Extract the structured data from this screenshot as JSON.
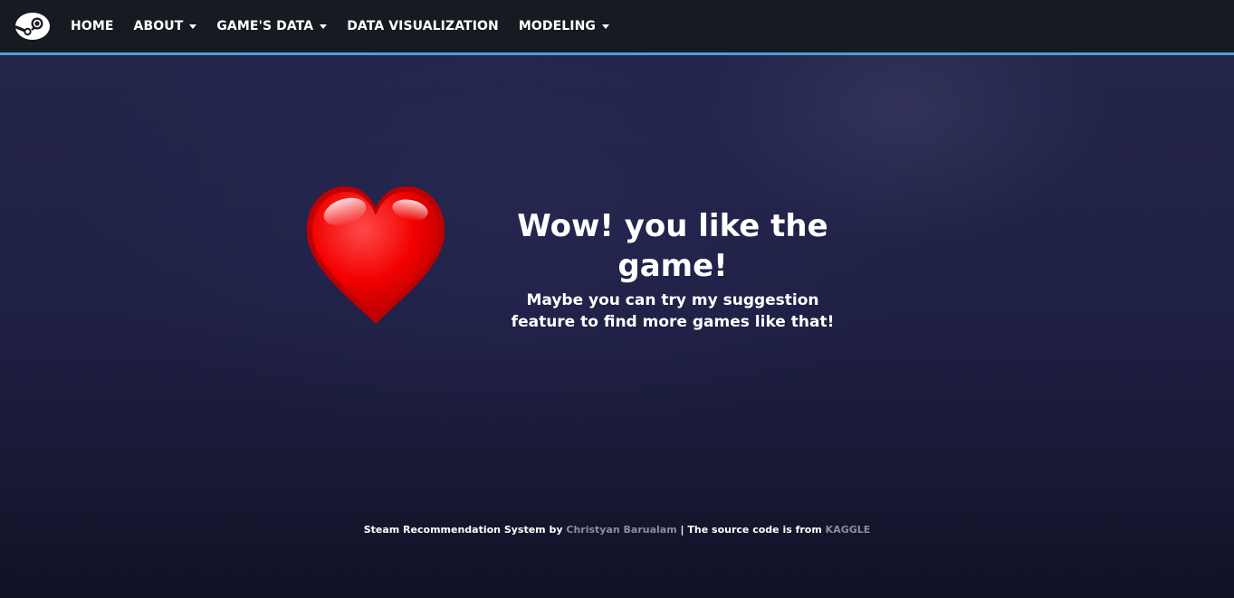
{
  "nav": {
    "logo_icon": "steam-logo-icon",
    "items": [
      {
        "label": "HOME",
        "dropdown": false
      },
      {
        "label": "ABOUT",
        "dropdown": true
      },
      {
        "label": "GAME'S DATA",
        "dropdown": true
      },
      {
        "label": "DATA VISUALIZATION",
        "dropdown": false
      },
      {
        "label": "MODELING",
        "dropdown": true
      }
    ],
    "accent_color": "#47a3d9",
    "background_color": "#171a21"
  },
  "hero": {
    "icon": "heart-icon",
    "title": "Wow! you like the game!",
    "subtitle_line1": "Maybe you can try my suggestion",
    "subtitle_line2": "feature to find more games like that!"
  },
  "footer": {
    "prefix": "Steam Recommendation System by",
    "author_link": "Christyan Barualam",
    "separator": "|",
    "middle": "The source code is from",
    "source_link": "KAGGLE"
  }
}
